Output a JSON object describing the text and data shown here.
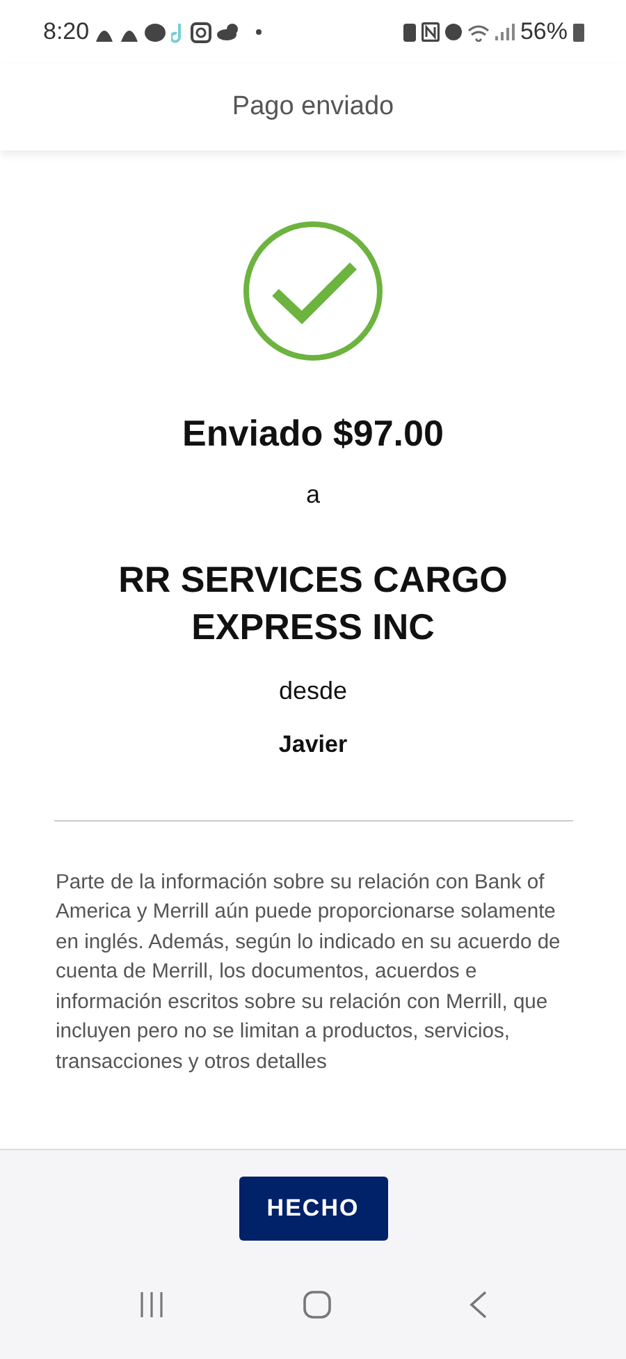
{
  "status_bar": {
    "time": "8:20",
    "battery": "56%"
  },
  "header": {
    "title": "Pago enviado"
  },
  "confirmation": {
    "amount_line": "Enviado $97.00",
    "to_word": "a",
    "recipient": "RR SERVICES CARGO EXPRESS INC",
    "from_word": "desde",
    "sender": "Javier"
  },
  "disclaimer": "Parte de la información sobre su relación con Bank of America y Merrill aún puede proporcionarse solamente en inglés. Además, según lo indicado en su acuerdo de cuenta de Merrill, los documentos, acuerdos e información escritos sobre su relación con Merrill, que incluyen pero no se limitan a productos, servicios, transacciones y otros detalles",
  "footer": {
    "button": "HECHO"
  }
}
